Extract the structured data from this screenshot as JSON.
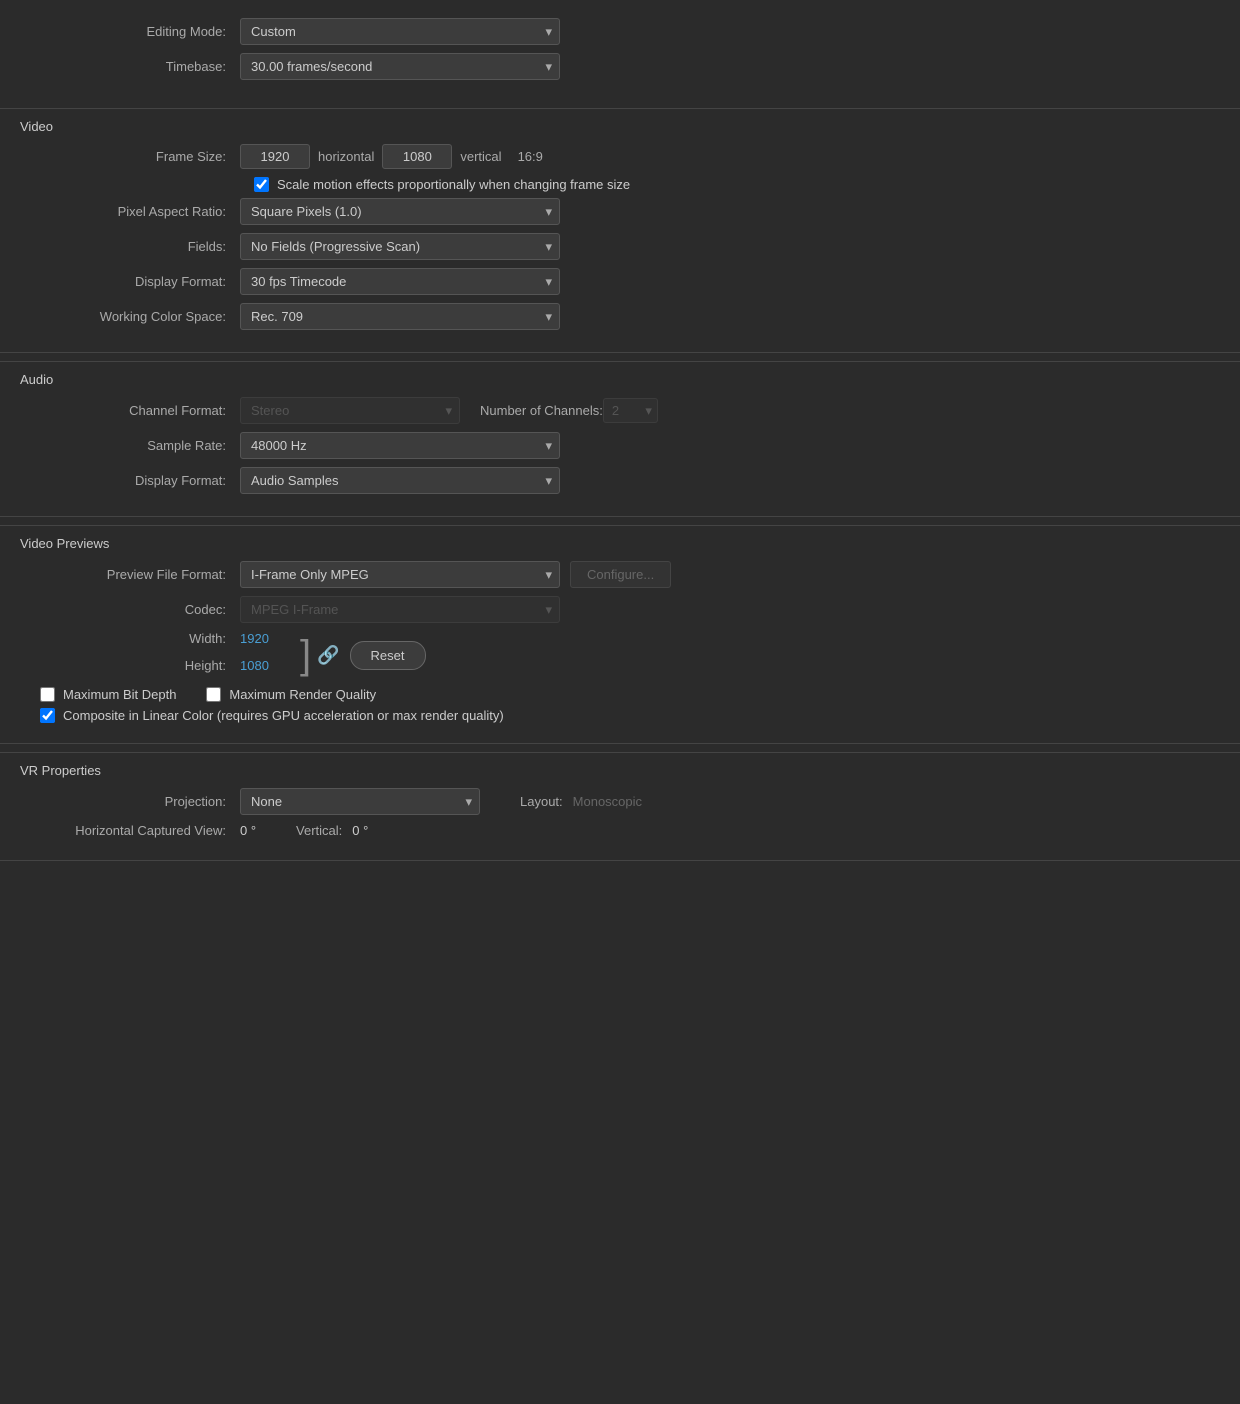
{
  "top": {
    "editing_mode_label": "Editing Mode:",
    "editing_mode_value": "Custom",
    "timebase_label": "Timebase:",
    "timebase_value": "30.00  frames/second"
  },
  "video": {
    "section_title": "Video",
    "frame_size_label": "Frame Size:",
    "frame_width": "1920",
    "horizontal_text": "horizontal",
    "frame_height": "1080",
    "vertical_text": "vertical",
    "aspect_ratio_text": "16:9",
    "scale_checkbox_label": "Scale motion effects proportionally when changing frame size",
    "pixel_aspect_ratio_label": "Pixel Aspect Ratio:",
    "pixel_aspect_ratio_value": "Square Pixels (1.0)",
    "fields_label": "Fields:",
    "fields_value": "No Fields (Progressive Scan)",
    "display_format_label": "Display Format:",
    "display_format_value": "30 fps Timecode",
    "working_color_space_label": "Working Color Space:",
    "working_color_space_value": "Rec. 709"
  },
  "audio": {
    "section_title": "Audio",
    "channel_format_label": "Channel Format:",
    "channel_format_value": "Stereo",
    "num_channels_label": "Number of Channels:",
    "num_channels_value": "2",
    "sample_rate_label": "Sample Rate:",
    "sample_rate_value": "48000 Hz",
    "display_format_label": "Display Format:",
    "display_format_value": "Audio Samples"
  },
  "video_previews": {
    "section_title": "Video Previews",
    "preview_file_format_label": "Preview File Format:",
    "preview_file_format_value": "I-Frame Only MPEG",
    "configure_btn_label": "Configure...",
    "codec_label": "Codec:",
    "codec_value": "MPEG I-Frame",
    "width_label": "Width:",
    "width_value": "1920",
    "height_label": "Height:",
    "height_value": "1080",
    "reset_btn_label": "Reset",
    "max_bit_depth_label": "Maximum Bit Depth",
    "max_render_quality_label": "Maximum Render Quality",
    "composite_label": "Composite in Linear Color (requires GPU acceleration or max render quality)"
  },
  "vr_properties": {
    "section_title": "VR Properties",
    "projection_label": "Projection:",
    "projection_value": "None",
    "layout_label": "Layout:",
    "layout_value": "Monoscopic",
    "horizontal_label": "Horizontal Captured View:",
    "horizontal_value": "0 °",
    "vertical_label": "Vertical:",
    "vertical_value": "0 °"
  }
}
